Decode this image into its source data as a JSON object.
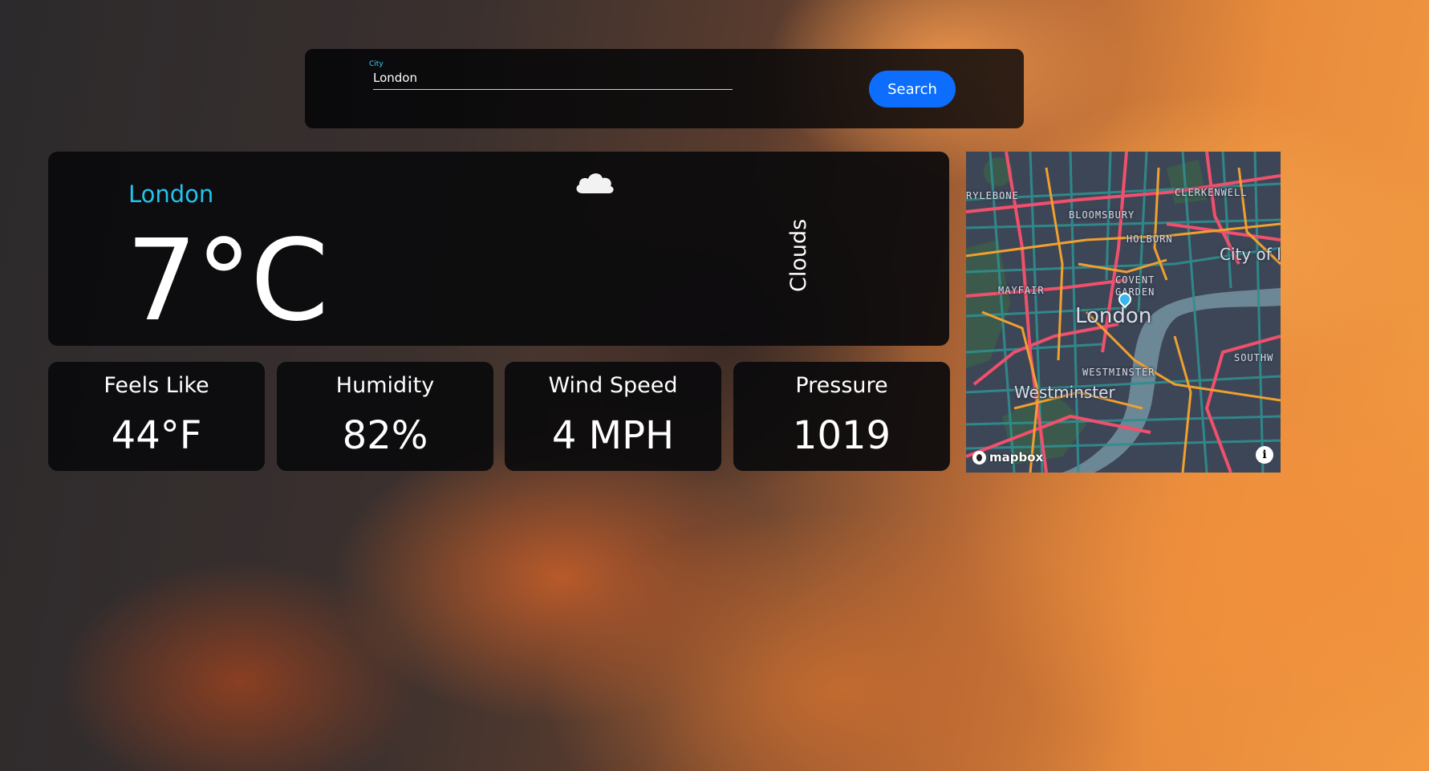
{
  "search": {
    "label": "City",
    "value": "London",
    "button_label": "Search"
  },
  "weather": {
    "city": "London",
    "temperature": "7°C",
    "condition": "Clouds",
    "icon": "cloud-icon"
  },
  "stats": {
    "feels_like": {
      "label": "Feels Like",
      "value": "44°F"
    },
    "humidity": {
      "label": "Humidity",
      "value": "82%"
    },
    "wind_speed": {
      "label": "Wind Speed",
      "value": "4 MPH"
    },
    "pressure": {
      "label": "Pressure",
      "value": "1019"
    }
  },
  "map": {
    "labels": {
      "marylebone": "RYLEBONE",
      "clerkenwell": "CLERKENWELL",
      "bloomsbury": "BLOOMSBURY",
      "holborn": "HOLBORN",
      "city_of": "City of l",
      "covent_garden_1": "COVENT",
      "covent_garden_2": "GARDEN",
      "mayfair": "MAYFAIR",
      "london": "London",
      "southwark": "SOUTHW",
      "westminster_small": "WESTMINSTER",
      "westminster": "Westminster"
    },
    "attribution": "mapbox",
    "info": "i"
  },
  "colors": {
    "accent": "#22c3ee",
    "button": "#0d6efd",
    "panel": "#0a0a0c"
  }
}
